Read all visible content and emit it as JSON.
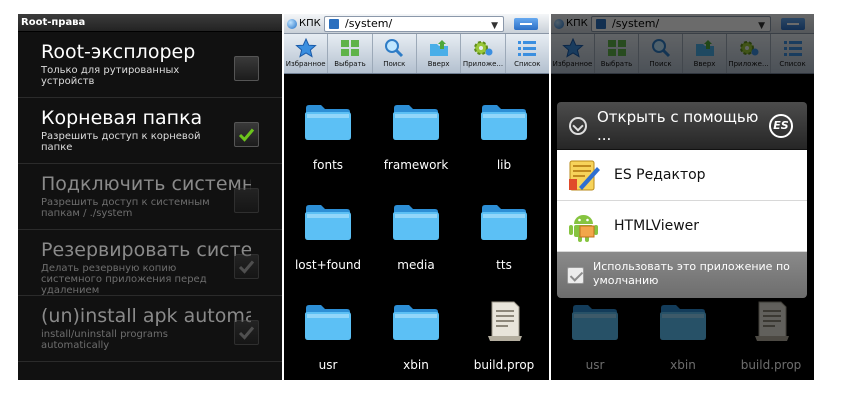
{
  "panel1": {
    "title": "Root-права",
    "prefs": [
      {
        "title": "Root-эксплорер",
        "summary": "Только для рутированных устройств",
        "checked": false,
        "enabled": true
      },
      {
        "title": "Корневая папка",
        "summary": "Разрешить доступ к корневой папке",
        "checked": true,
        "enabled": true
      },
      {
        "title": "Подключить системные",
        "summary": "Разрешить доступ к системным папкам / ./system",
        "checked": false,
        "enabled": false
      },
      {
        "title": "Резервировать системные",
        "summary": "Делать резервную копию системного приложения перед удалением",
        "checked": true,
        "enabled": false
      },
      {
        "title": "(un)install apk automatically",
        "summary": "install/uninstall programs automatically",
        "checked": true,
        "enabled": false
      }
    ]
  },
  "filemanager": {
    "net_label": "КПК",
    "path": "/system/",
    "toolbar": [
      "Избранное",
      "Выбрать",
      "Поиск",
      "Вверх",
      "Приложе...",
      "Список"
    ],
    "toolbar_icons": [
      "star-icon",
      "select-grid-icon",
      "magnifier-icon",
      "folder-up-icon",
      "apps-gear-icon",
      "list-view-icon"
    ],
    "files": [
      {
        "name": "fonts",
        "kind": "folder"
      },
      {
        "name": "framework",
        "kind": "folder"
      },
      {
        "name": "lib",
        "kind": "folder"
      },
      {
        "name": "lost+found",
        "kind": "folder"
      },
      {
        "name": "media",
        "kind": "folder"
      },
      {
        "name": "tts",
        "kind": "folder"
      },
      {
        "name": "usr",
        "kind": "folder"
      },
      {
        "name": "xbin",
        "kind": "folder"
      },
      {
        "name": "build.prop",
        "kind": "file"
      }
    ]
  },
  "dialog": {
    "title": "Открыть с помощью ...",
    "options": [
      {
        "label": "ES Редактор",
        "icon": "es-editor-icon"
      },
      {
        "label": "HTMLViewer",
        "icon": "android-icon"
      }
    ],
    "default_label": "Использовать это приложение по умолчанию"
  },
  "colors": {
    "folder": "#4fb4ee",
    "accent": "#2c6fc5",
    "check": "#6cc51c"
  }
}
